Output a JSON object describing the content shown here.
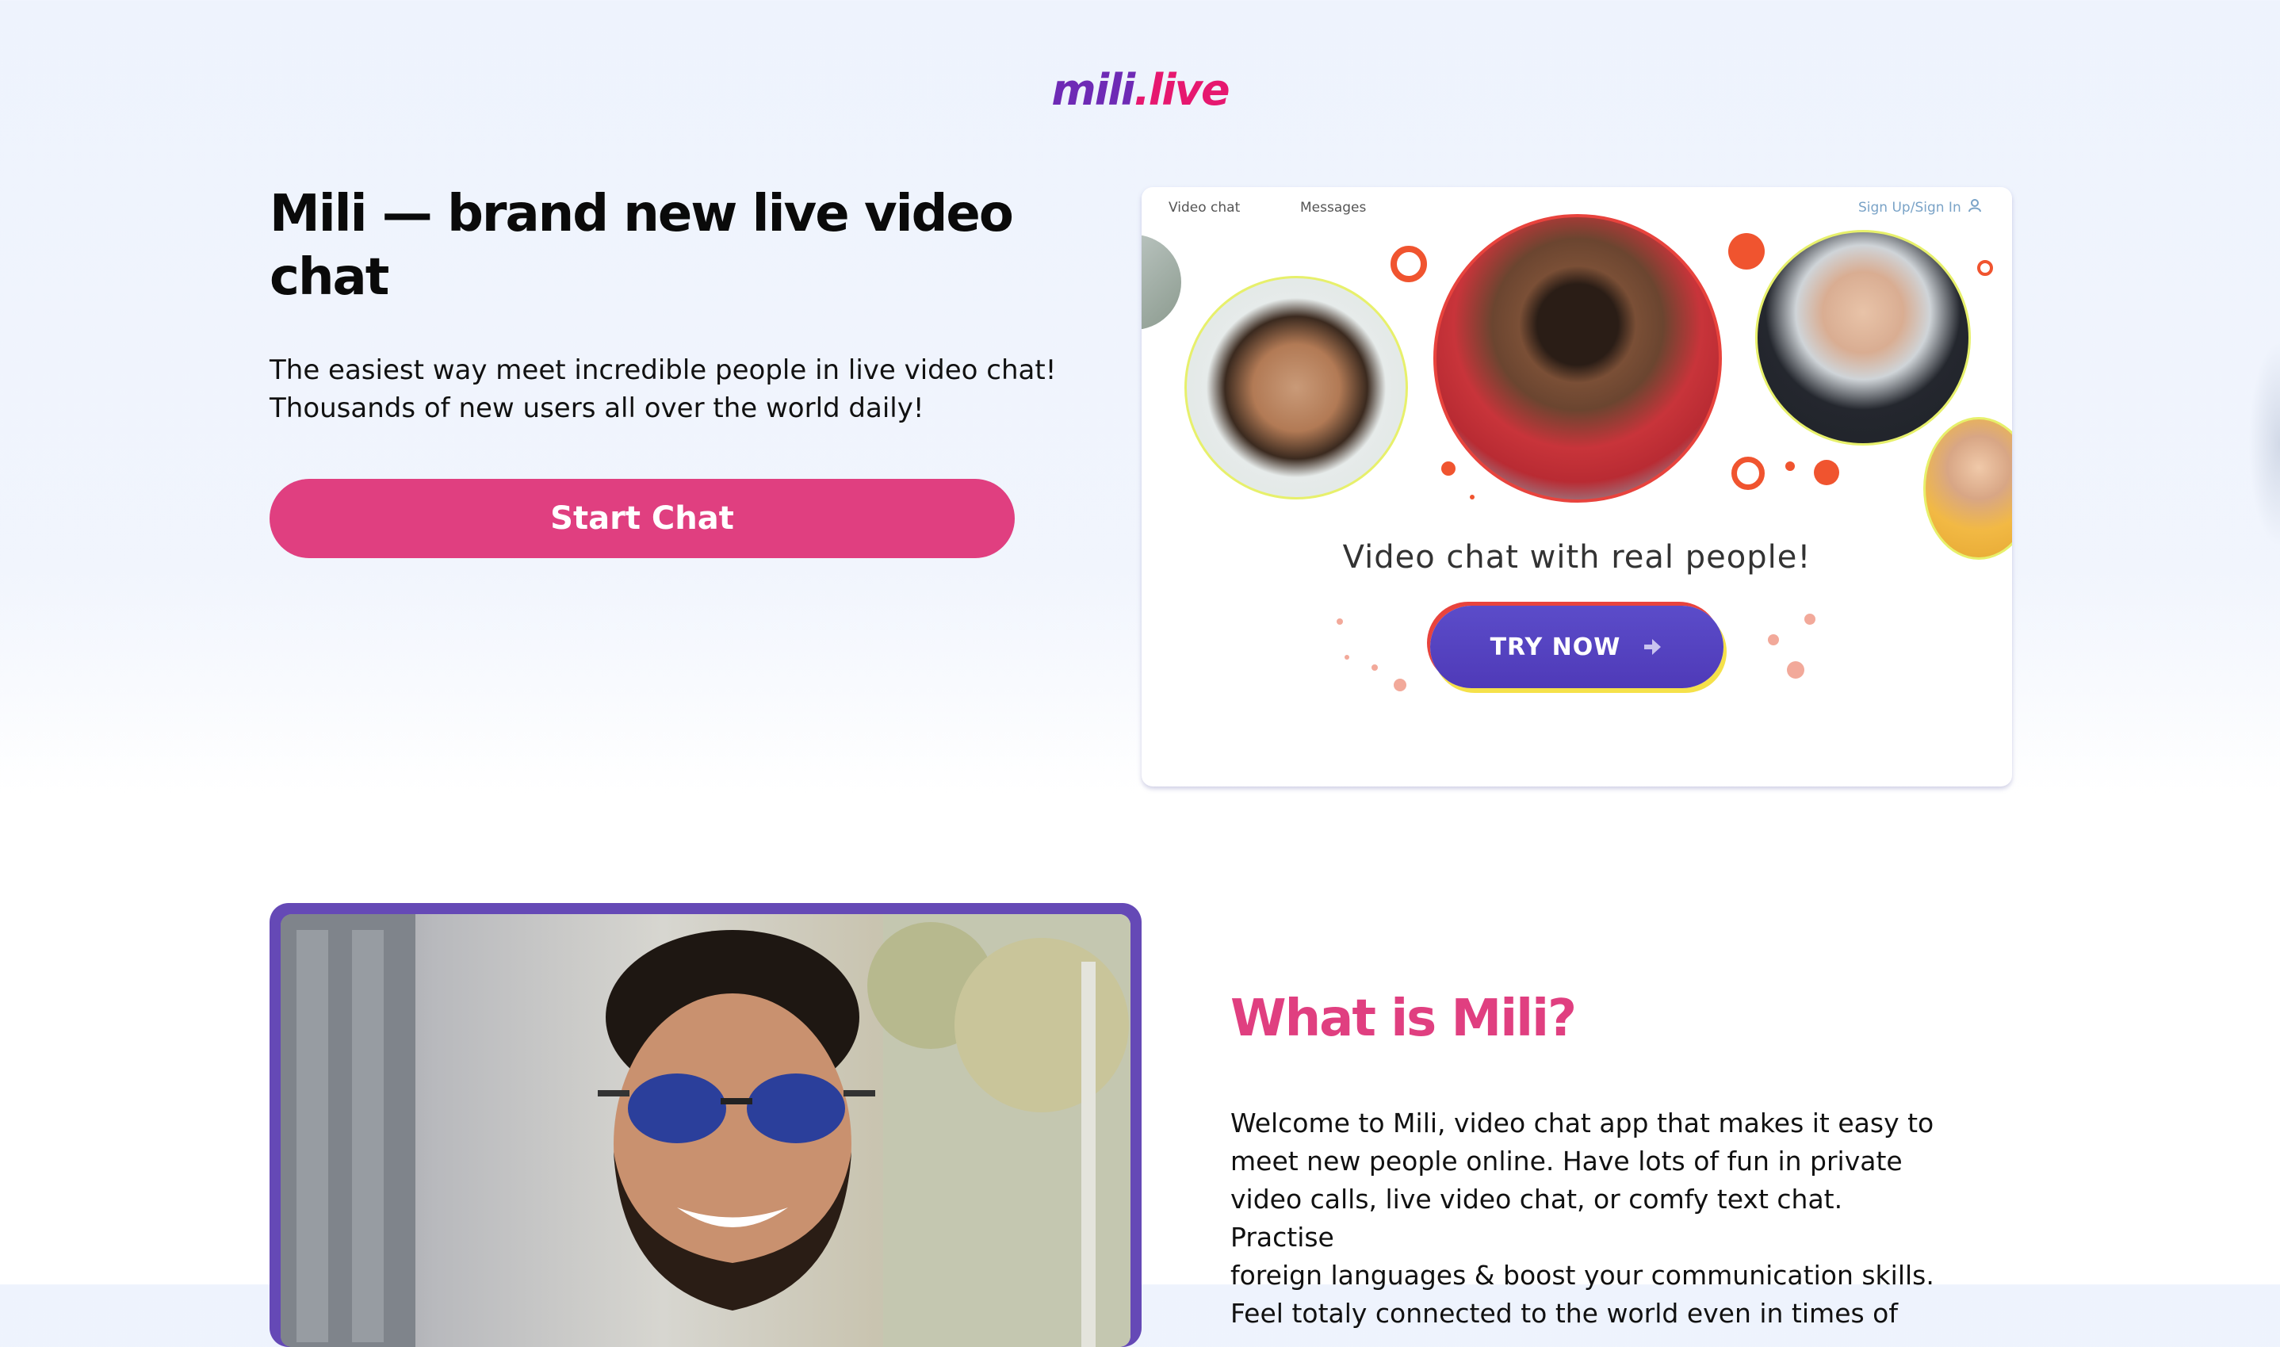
{
  "logo": {
    "part1": "mili",
    "part2": ".live"
  },
  "hero": {
    "title": "Mili — brand new live video chat",
    "subtitle_line1": "The easiest way meet incredible people in live video chat!",
    "subtitle_line2": "Thousands of new users all over the world daily!",
    "cta": "Start Chat"
  },
  "promo": {
    "nav": {
      "video_chat": "Video chat",
      "messages": "Messages",
      "sign_in": "Sign Up/Sign In"
    },
    "heading": "Video chat with real people!",
    "button": "TRY NOW"
  },
  "about": {
    "title": "What is Mili?",
    "text_lines": [
      "Welcome to Mili, video chat app that makes it easy to",
      "meet new people online. Have lots of fun in private",
      "video calls, live video chat, or comfy text chat. Practise",
      "foreign languages & boost your communication skills.",
      "Feel totaly connected to the world even in times of"
    ]
  },
  "colors": {
    "brand_pink": "#e03f80",
    "brand_purple": "#6e2ab5",
    "button_purple": "#5b4cc9",
    "frame_purple": "#6549b6"
  },
  "icons": [
    "user-icon",
    "arrow-right-icon"
  ]
}
